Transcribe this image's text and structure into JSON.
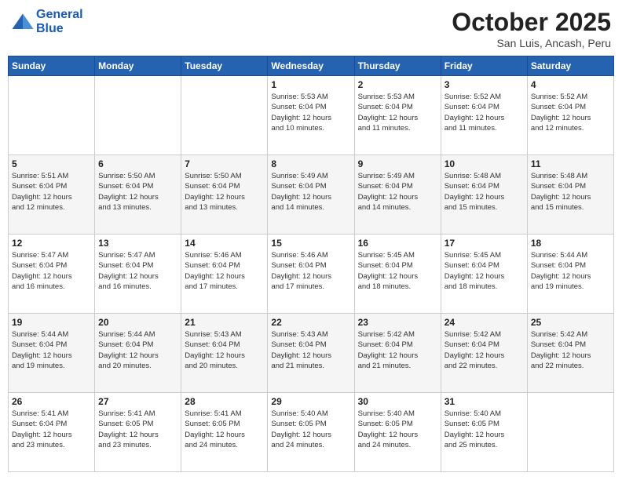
{
  "header": {
    "logo_line1": "General",
    "logo_line2": "Blue",
    "title": "October 2025",
    "subtitle": "San Luis, Ancash, Peru"
  },
  "weekdays": [
    "Sunday",
    "Monday",
    "Tuesday",
    "Wednesday",
    "Thursday",
    "Friday",
    "Saturday"
  ],
  "weeks": [
    [
      {
        "day": "",
        "info": ""
      },
      {
        "day": "",
        "info": ""
      },
      {
        "day": "",
        "info": ""
      },
      {
        "day": "1",
        "info": "Sunrise: 5:53 AM\nSunset: 6:04 PM\nDaylight: 12 hours\nand 10 minutes."
      },
      {
        "day": "2",
        "info": "Sunrise: 5:53 AM\nSunset: 6:04 PM\nDaylight: 12 hours\nand 11 minutes."
      },
      {
        "day": "3",
        "info": "Sunrise: 5:52 AM\nSunset: 6:04 PM\nDaylight: 12 hours\nand 11 minutes."
      },
      {
        "day": "4",
        "info": "Sunrise: 5:52 AM\nSunset: 6:04 PM\nDaylight: 12 hours\nand 12 minutes."
      }
    ],
    [
      {
        "day": "5",
        "info": "Sunrise: 5:51 AM\nSunset: 6:04 PM\nDaylight: 12 hours\nand 12 minutes."
      },
      {
        "day": "6",
        "info": "Sunrise: 5:50 AM\nSunset: 6:04 PM\nDaylight: 12 hours\nand 13 minutes."
      },
      {
        "day": "7",
        "info": "Sunrise: 5:50 AM\nSunset: 6:04 PM\nDaylight: 12 hours\nand 13 minutes."
      },
      {
        "day": "8",
        "info": "Sunrise: 5:49 AM\nSunset: 6:04 PM\nDaylight: 12 hours\nand 14 minutes."
      },
      {
        "day": "9",
        "info": "Sunrise: 5:49 AM\nSunset: 6:04 PM\nDaylight: 12 hours\nand 14 minutes."
      },
      {
        "day": "10",
        "info": "Sunrise: 5:48 AM\nSunset: 6:04 PM\nDaylight: 12 hours\nand 15 minutes."
      },
      {
        "day": "11",
        "info": "Sunrise: 5:48 AM\nSunset: 6:04 PM\nDaylight: 12 hours\nand 15 minutes."
      }
    ],
    [
      {
        "day": "12",
        "info": "Sunrise: 5:47 AM\nSunset: 6:04 PM\nDaylight: 12 hours\nand 16 minutes."
      },
      {
        "day": "13",
        "info": "Sunrise: 5:47 AM\nSunset: 6:04 PM\nDaylight: 12 hours\nand 16 minutes."
      },
      {
        "day": "14",
        "info": "Sunrise: 5:46 AM\nSunset: 6:04 PM\nDaylight: 12 hours\nand 17 minutes."
      },
      {
        "day": "15",
        "info": "Sunrise: 5:46 AM\nSunset: 6:04 PM\nDaylight: 12 hours\nand 17 minutes."
      },
      {
        "day": "16",
        "info": "Sunrise: 5:45 AM\nSunset: 6:04 PM\nDaylight: 12 hours\nand 18 minutes."
      },
      {
        "day": "17",
        "info": "Sunrise: 5:45 AM\nSunset: 6:04 PM\nDaylight: 12 hours\nand 18 minutes."
      },
      {
        "day": "18",
        "info": "Sunrise: 5:44 AM\nSunset: 6:04 PM\nDaylight: 12 hours\nand 19 minutes."
      }
    ],
    [
      {
        "day": "19",
        "info": "Sunrise: 5:44 AM\nSunset: 6:04 PM\nDaylight: 12 hours\nand 19 minutes."
      },
      {
        "day": "20",
        "info": "Sunrise: 5:44 AM\nSunset: 6:04 PM\nDaylight: 12 hours\nand 20 minutes."
      },
      {
        "day": "21",
        "info": "Sunrise: 5:43 AM\nSunset: 6:04 PM\nDaylight: 12 hours\nand 20 minutes."
      },
      {
        "day": "22",
        "info": "Sunrise: 5:43 AM\nSunset: 6:04 PM\nDaylight: 12 hours\nand 21 minutes."
      },
      {
        "day": "23",
        "info": "Sunrise: 5:42 AM\nSunset: 6:04 PM\nDaylight: 12 hours\nand 21 minutes."
      },
      {
        "day": "24",
        "info": "Sunrise: 5:42 AM\nSunset: 6:04 PM\nDaylight: 12 hours\nand 22 minutes."
      },
      {
        "day": "25",
        "info": "Sunrise: 5:42 AM\nSunset: 6:04 PM\nDaylight: 12 hours\nand 22 minutes."
      }
    ],
    [
      {
        "day": "26",
        "info": "Sunrise: 5:41 AM\nSunset: 6:04 PM\nDaylight: 12 hours\nand 23 minutes."
      },
      {
        "day": "27",
        "info": "Sunrise: 5:41 AM\nSunset: 6:05 PM\nDaylight: 12 hours\nand 23 minutes."
      },
      {
        "day": "28",
        "info": "Sunrise: 5:41 AM\nSunset: 6:05 PM\nDaylight: 12 hours\nand 24 minutes."
      },
      {
        "day": "29",
        "info": "Sunrise: 5:40 AM\nSunset: 6:05 PM\nDaylight: 12 hours\nand 24 minutes."
      },
      {
        "day": "30",
        "info": "Sunrise: 5:40 AM\nSunset: 6:05 PM\nDaylight: 12 hours\nand 24 minutes."
      },
      {
        "day": "31",
        "info": "Sunrise: 5:40 AM\nSunset: 6:05 PM\nDaylight: 12 hours\nand 25 minutes."
      },
      {
        "day": "",
        "info": ""
      }
    ]
  ]
}
